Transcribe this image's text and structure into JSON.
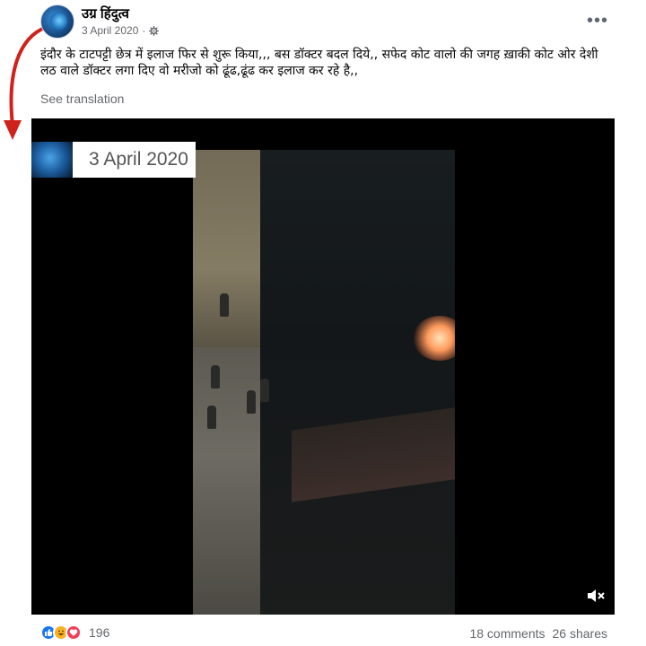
{
  "post": {
    "author": "उग्र हिंदुत्व",
    "date": "3 April 2020",
    "separator": "·",
    "privacy_icon": "gear-icon",
    "more_label": "•••",
    "text": "इंदौर के टाटपट्टी छेत्र में इलाज फिर से शुरू किया,,, बस डॉक्टर बदल दिये,, सफेद कोट वालो की जगह ख़ाकी कोट ओर देशी लठ वाले डॉक्टर लगा दिए वो मरीजो को ढूंढ,ढूंढ कर इलाज कर रहे है,,",
    "see_translation": "See translation"
  },
  "video": {
    "stamp_date": "3 April 2020",
    "mute_icon": "speaker-muted-icon"
  },
  "footer": {
    "reaction_icons": [
      "like-icon",
      "haha-icon",
      "love-icon"
    ],
    "reaction_count": "196",
    "comments": "18 comments",
    "shares": "26 shares"
  },
  "colors": {
    "annotation_arrow": "#d0221c",
    "like": "#1877f2",
    "haha": "#f7b125",
    "love": "#f33e58",
    "secondary_text": "#65676b"
  }
}
